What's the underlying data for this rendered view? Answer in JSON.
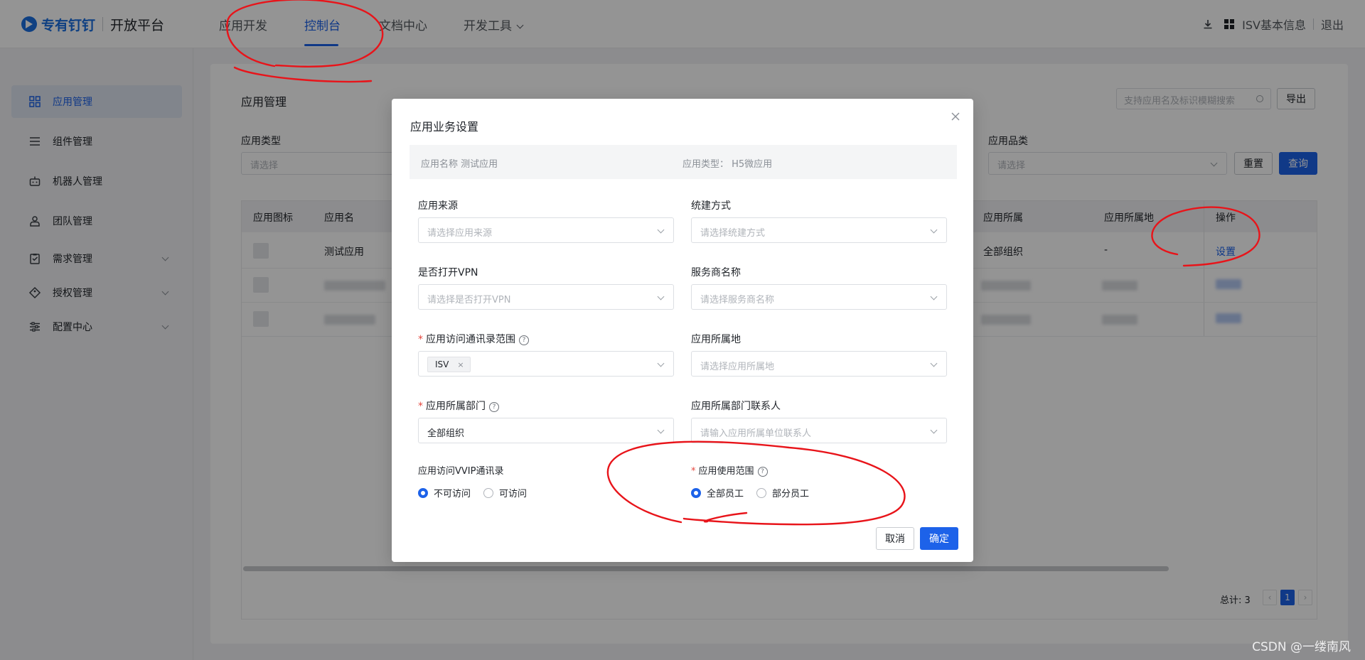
{
  "header": {
    "brand": "专有钉钉",
    "platform": "开放平台",
    "nav": [
      "应用开发",
      "控制台",
      "文档中心",
      "开发工具"
    ],
    "right": {
      "info": "ISV基本信息",
      "logout": "退出"
    }
  },
  "sidebar": {
    "items": [
      {
        "label": "应用管理",
        "icon": "grid-icon"
      },
      {
        "label": "组件管理",
        "icon": "list-icon"
      },
      {
        "label": "机器人管理",
        "icon": "robot-icon"
      },
      {
        "label": "团队管理",
        "icon": "team-icon"
      },
      {
        "label": "需求管理",
        "icon": "clipboard-icon"
      },
      {
        "label": "授权管理",
        "icon": "tag-icon"
      },
      {
        "label": "配置中心",
        "icon": "sliders-icon"
      }
    ]
  },
  "main": {
    "title": "应用管理",
    "search_placeholder": "支持应用名及标识模糊搜索",
    "export_label": "导出",
    "filter_type_label": "应用类型",
    "filter_type_placeholder": "请选择",
    "filter_category_label": "应用品类",
    "filter_category_placeholder": "请选择",
    "reset_label": "重置",
    "query_label": "查询",
    "table": {
      "headers": [
        "应用图标",
        "应用名",
        "应用所属",
        "应用所属地",
        "操作"
      ],
      "row1": {
        "name": "测试应用",
        "org": "全部组织",
        "region": "-",
        "action": "设置"
      }
    },
    "pager": {
      "total": "总计: 3",
      "current": "1",
      "prev": "‹",
      "next": "›"
    }
  },
  "modal": {
    "title": "应用业务设置",
    "info_name": "应用名称 测试应用",
    "info_type": "应用类型： H5微应用",
    "fields": {
      "source": {
        "label": "应用来源",
        "placeholder": "请选择应用来源"
      },
      "build": {
        "label": "统建方式",
        "placeholder": "请选择统建方式"
      },
      "vpn": {
        "label": "是否打开VPN",
        "placeholder": "请选择是否打开VPN"
      },
      "vendor": {
        "label": "服务商名称",
        "placeholder": "请选择服务商名称"
      },
      "scope": {
        "label": "应用访问通讯录范围",
        "tag": "ISV"
      },
      "region": {
        "label": "应用所属地",
        "placeholder": "请选择应用所属地"
      },
      "dept": {
        "label": "应用所属部门",
        "value": "全部组织"
      },
      "contact": {
        "label": "应用所属部门联系人",
        "placeholder": "请输入应用所属单位联系人"
      },
      "vvip": {
        "label": "应用访问VVIP通讯录",
        "options": [
          "不可访问",
          "可访问"
        ]
      },
      "usage": {
        "label": "应用使用范围",
        "options": [
          "全部员工",
          "部分员工"
        ]
      }
    },
    "cancel_label": "取消",
    "ok_label": "确定"
  },
  "watermark": "CSDN @一缕南风",
  "colors": {
    "primary": "#1d62e9",
    "annotation": "#e8141a"
  }
}
